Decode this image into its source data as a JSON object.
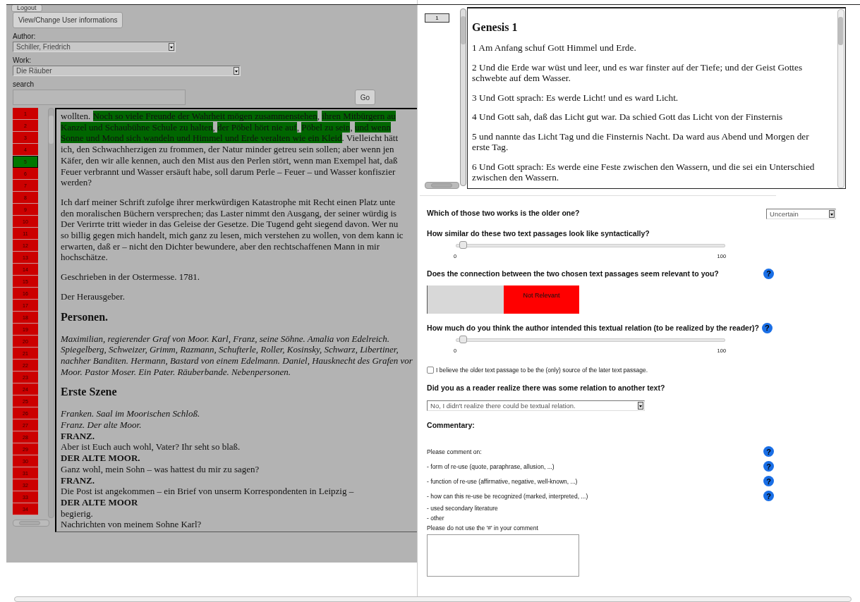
{
  "left": {
    "logout_button": "Logout",
    "user_button": "View/Change User informations",
    "author": {
      "label": "Author:",
      "value": "Schiller, Friedrich"
    },
    "work": {
      "label": "Work:",
      "value": "Die Räuber"
    },
    "search": {
      "label": "search",
      "go_button": "Go"
    },
    "line_numbers": [
      {
        "label": "1",
        "selected": false
      },
      {
        "label": "2",
        "selected": false
      },
      {
        "label": "3",
        "selected": false
      },
      {
        "label": "4",
        "selected": false
      },
      {
        "label": "5",
        "selected": true
      },
      {
        "label": "6",
        "selected": false
      },
      {
        "label": "7",
        "selected": false
      },
      {
        "label": "8",
        "selected": false
      },
      {
        "label": "9",
        "selected": false
      },
      {
        "label": "10",
        "selected": false
      },
      {
        "label": "11",
        "selected": false
      },
      {
        "label": "12",
        "selected": false
      },
      {
        "label": "13",
        "selected": false
      },
      {
        "label": "14",
        "selected": false
      },
      {
        "label": "15",
        "selected": false
      },
      {
        "label": "16",
        "selected": false
      },
      {
        "label": "17",
        "selected": false
      },
      {
        "label": "18",
        "selected": false
      },
      {
        "label": "19",
        "selected": false
      },
      {
        "label": "20",
        "selected": false
      },
      {
        "label": "21",
        "selected": false
      },
      {
        "label": "22",
        "selected": false
      },
      {
        "label": "23",
        "selected": false
      },
      {
        "label": "24",
        "selected": false
      },
      {
        "label": "25",
        "selected": false
      },
      {
        "label": "26",
        "selected": false
      },
      {
        "label": "27",
        "selected": false
      },
      {
        "label": "28",
        "selected": false
      },
      {
        "label": "29",
        "selected": false
      },
      {
        "label": "30",
        "selected": false
      },
      {
        "label": "31",
        "selected": false
      },
      {
        "label": "32",
        "selected": false
      },
      {
        "label": "33",
        "selected": false
      },
      {
        "label": "34",
        "selected": false
      }
    ],
    "passage": [
      {
        "kind": "para",
        "lines": [
          {
            "segments": [
              {
                "text": "wollten. ",
                "highlighted": false
              },
              {
                "text": "Noch so viele Freunde der Wahrheit mögen zusammenstehen",
                "highlighted": true
              },
              {
                "text": ", ",
                "highlighted": false
              },
              {
                "text": "ihren Mitbürgern au",
                "highlighted": true
              }
            ]
          },
          {
            "segments": [
              {
                "text": "Kanzel und Schaubühne Schule zu halten",
                "highlighted": true
              },
              {
                "text": ", ",
                "highlighted": false
              },
              {
                "text": "der Pöbel hört nie auf",
                "highlighted": true
              },
              {
                "text": ", ",
                "highlighted": false
              },
              {
                "text": "Pöbel zu sein",
                "highlighted": true
              },
              {
                "text": ", ",
                "highlighted": false
              },
              {
                "text": "und wenn",
                "highlighted": true
              }
            ]
          },
          {
            "segments": [
              {
                "text": "Sonne und Mond sich wandeln und Himmel und Erde veralten wie ein Kleid",
                "highlighted": true
              },
              {
                "text": ". Vielleicht hätt",
                "highlighted": false
              }
            ]
          },
          {
            "text": "ich, den Schwachherzigen zu frommen, der Natur minder getreu sein sollen; aber wenn jen"
          },
          {
            "text": "Käfer, den wir alle kennen, auch den Mist aus den Perlen stört, wenn man Exempel hat, daß"
          },
          {
            "text": "Feuer verbrannt und Wasser ersäuft habe, soll darum Perle – Feuer – und Wasser konfiszier"
          },
          {
            "text": "werden?"
          }
        ]
      },
      {
        "kind": "para",
        "lines": [
          {
            "text": "Ich darf meiner Schrift zufolge ihrer merkwürdigen Katastrophe mit Recht einen Platz unte"
          },
          {
            "text": "den moralischen Büchern versprechen; das Laster nimmt den Ausgang, der seiner würdig is"
          },
          {
            "text": "Der Verirrte tritt wieder in das Geleise der Gesetze. Die Tugend geht siegend davon. Wer nu"
          },
          {
            "text": "so billig gegen mich handelt, mich ganz zu lesen, mich verstehen zu wollen, von dem kann ic"
          },
          {
            "text": "erwarten, daß er – nicht den Dichter bewundere, aber den rechtschaffenen Mann in mir"
          },
          {
            "text": "hochschätze."
          }
        ]
      },
      {
        "kind": "para",
        "lines": [
          {
            "text": "Geschrieben in der Ostermesse. 1781."
          }
        ]
      },
      {
        "kind": "para",
        "lines": [
          {
            "text": "Der Herausgeber."
          }
        ]
      },
      {
        "kind": "heading",
        "lines": [
          {
            "text": "Personen."
          }
        ]
      },
      {
        "kind": "italic",
        "lines": [
          {
            "text": "Maximilian, regierender Graf von Moor. Karl, Franz, seine Söhne. Amalia von Edelreich."
          },
          {
            "text": "Spiegelberg, Schweizer, Grimm, Razmann, Schufterle, Roller, Kosinsky, Schwarz, Libertiner,"
          },
          {
            "text": "nachher Banditen. Hermann, Bastard von einem Edelmann. Daniel, Hausknecht des Grafen vor"
          },
          {
            "text": "Moor. Pastor Moser. Ein Pater. Räuberbande. Nebenpersonen."
          }
        ]
      },
      {
        "kind": "heading",
        "lines": [
          {
            "text": "Erste Szene"
          }
        ]
      },
      {
        "kind": "script",
        "lines": [
          {
            "text": "Franken. Saal im Moorischen Schloß.",
            "kind": "direction"
          },
          {
            "text": "Franz. Der alte Moor.",
            "kind": "direction"
          },
          {
            "text": "FRANZ.",
            "kind": "speaker"
          },
          {
            "text": "Aber ist Euch auch wohl, Vater? Ihr seht so blaß.",
            "kind": "speech"
          },
          {
            "text": "DER ALTE MOOR.",
            "kind": "speaker"
          },
          {
            "text": "Ganz wohl, mein Sohn – was hattest du mir zu sagen?",
            "kind": "speech"
          },
          {
            "text": "FRANZ.",
            "kind": "speaker"
          },
          {
            "text": "Die Post ist angekommen – ein Brief von unserm Korrespondenten in Leipzig –",
            "kind": "speech"
          },
          {
            "text": "DER ALTE MOOR",
            "kind": "speaker"
          },
          {
            "text": "begierig.",
            "kind": "speech"
          },
          {
            "text": "Nachrichten von meinem Sohne Karl?",
            "kind": "speech"
          }
        ]
      }
    ]
  },
  "right": {
    "line_numbers": [
      {
        "label": "1",
        "selected": false
      }
    ],
    "passage": [
      {
        "kind": "heading",
        "text": "Genesis 1"
      },
      {
        "kind": "verse",
        "text": "1 Am Anfang schuf Gott Himmel und Erde."
      },
      {
        "kind": "verse",
        "text": "2 Und die Erde war wüst und leer, und es war finster auf der Tiefe; und der Geist Gottes schwebte auf dem Wasser."
      },
      {
        "kind": "verse",
        "text": "3 Und Gott sprach: Es werde Licht! und es ward Licht."
      },
      {
        "kind": "verse",
        "text": "4 Und Gott sah, daß das Licht gut war. Da schied Gott das Licht von der Finsternis"
      },
      {
        "kind": "verse",
        "text": "5 und nannte das Licht Tag und die Finsternis Nacht. Da ward aus Abend und Morgen der erste Tag."
      },
      {
        "kind": "verse",
        "text": "6 Und Gott sprach: Es werde eine Feste zwischen den Wassern, und die sei ein Unterschied zwischen den Wassern."
      }
    ]
  },
  "form": [
    {
      "kind": "select_question",
      "question": "Which of those two works is the older one?",
      "value": "Uncertain"
    },
    {
      "kind": "slider",
      "question": "How similar do these two text passages look like syntactically?",
      "level": 0.01,
      "min_label": "0",
      "max_label": "100"
    },
    {
      "kind": "toggle",
      "question": "Does the connection between the two chosen text passages seem relevant to you?",
      "help": "?",
      "label": "Not Relevant",
      "on": false
    },
    {
      "kind": "slider",
      "question": "How much do you think the author intended this textual relation (to be realized by the reader)?",
      "help": "?",
      "level": 0.01,
      "min_label": "0",
      "max_label": "100"
    },
    {
      "kind": "checkbox",
      "label": "I believe the older text passage to be the (only) source of the later text passage.",
      "checked": false
    },
    {
      "kind": "dropdown",
      "question": "Did you as a reader realize there was some relation to another text?",
      "value": "No, I didn't realize there could be textual relation."
    },
    {
      "kind": "comment",
      "question": "Commentary:",
      "items": [
        {
          "text": "Please comment on:",
          "help": "?"
        },
        {
          "text": "- form of re-use (quote, paraphrase, allusion, ...)",
          "help": "?"
        },
        {
          "text": "- function of re-use (affirmative, negative, well-known, ...)",
          "help": "?"
        },
        {
          "text": "- how can this re-use be recognized (marked, interpreted, ...)",
          "help": "?"
        },
        {
          "text": "- used secondary literature"
        },
        {
          "text": "- other"
        },
        {
          "text": "Please do not use the '#' in your comment"
        }
      ]
    }
  ]
}
